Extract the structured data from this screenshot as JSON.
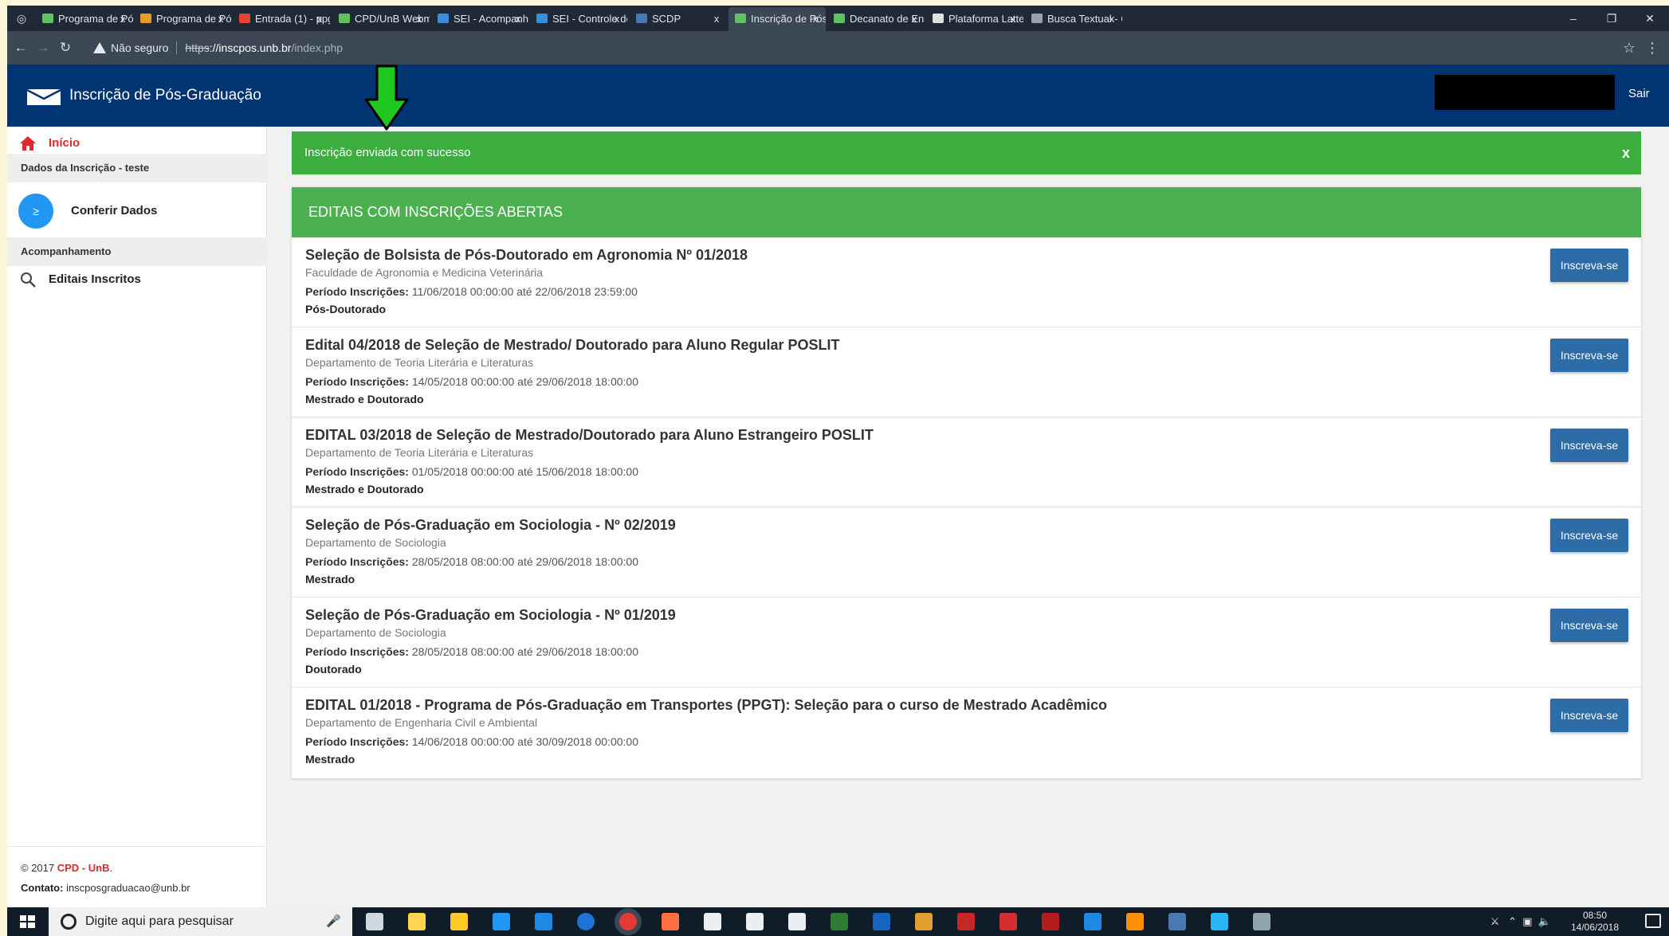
{
  "browser": {
    "tabs": [
      {
        "label": "Programa de Pós",
        "color": "#5fc15f"
      },
      {
        "label": "Programa de Pós",
        "color": "#e89b2a"
      },
      {
        "label": "Entrada (1) - ppg",
        "color": "#e84235"
      },
      {
        "label": "CPD/UnB Webma",
        "color": "#5fc15f"
      },
      {
        "label": "SEI - Acompanha",
        "color": "#3b8ed8"
      },
      {
        "label": "SEI - Controle de",
        "color": "#3b8ed8"
      },
      {
        "label": "SCDP",
        "color": "#4a78b5"
      },
      {
        "label": "Inscrição de Pós-",
        "color": "#5fc15f"
      },
      {
        "label": "Decanato de Ensi",
        "color": "#5fc15f"
      },
      {
        "label": "Plataforma Lattes",
        "color": "#e0e0e0"
      },
      {
        "label": "Busca Textual - C",
        "color": "#9aa0b0"
      }
    ],
    "tab_close": "x",
    "security_label": "Não seguro",
    "url_proto": "https",
    "url_host": "://inscpos.unb.br",
    "url_path": "/index.php"
  },
  "header": {
    "title": "Inscrição de Pós-Graduação",
    "logout": "Sair"
  },
  "sidebar": {
    "home": "Início",
    "section_dados": "Dados da Inscrição - teste",
    "conferir": "Conferir Dados",
    "section_acomp": "Acompanhamento",
    "editais": "Editais Inscritos",
    "footer_year": "© 2017",
    "footer_org": "CPD - UnB",
    "footer_dot": ".",
    "footer_contact_label": "Contato:",
    "footer_contact": "inscposgraduacao@unb.br"
  },
  "alert": {
    "message": "Inscrição enviada com sucesso",
    "close": "x"
  },
  "panel": {
    "heading": "EDITAIS COM INSCRIÇÕES ABERTAS",
    "period_label": "Período Inscrições:",
    "button_label": "Inscreva-se",
    "items": [
      {
        "title": "Seleção de Bolsista de Pós-Doutorado em Agronomia Nº 01/2018",
        "dept": "Faculdade de Agronomia e Medicina Veterinária",
        "period": "11/06/2018 00:00:00 até 22/06/2018 23:59:00",
        "level": "Pós-Doutorado"
      },
      {
        "title": "Edital 04/2018 de Seleção de Mestrado/ Doutorado para Aluno Regular POSLIT",
        "dept": "Departamento de Teoria Literária e Literaturas",
        "period": "14/05/2018 00:00:00 até 29/06/2018 18:00:00",
        "level": "Mestrado e Doutorado"
      },
      {
        "title": "EDITAL 03/2018 de Seleção de Mestrado/Doutorado para Aluno Estrangeiro POSLIT",
        "dept": "Departamento de Teoria Literária e Literaturas",
        "period": "01/05/2018 00:00:00 até 15/06/2018 18:00:00",
        "level": "Mestrado e Doutorado"
      },
      {
        "title": "Seleção de Pós-Graduação em Sociologia - Nº 02/2019",
        "dept": "Departamento de Sociologia",
        "period": "28/05/2018 08:00:00 até 29/06/2018 18:00:00",
        "level": "Mestrado"
      },
      {
        "title": "Seleção de Pós-Graduação em Sociologia - Nº 01/2019",
        "dept": "Departamento de Sociologia",
        "period": "28/05/2018 08:00:00 até 29/06/2018 18:00:00",
        "level": "Doutorado"
      },
      {
        "title": "EDITAL 01/2018 - Programa de Pós-Graduação em Transportes (PPGT): Seleção para o curso de Mestrado Acadêmico",
        "dept": "Departamento de Engenharia Civil e Ambiental",
        "period": "14/06/2018 00:00:00 até 30/09/2018 00:00:00",
        "level": "Mestrado"
      }
    ]
  },
  "taskbar": {
    "search_placeholder": "Digite aqui para pesquisar",
    "time": "08:50",
    "date": "14/06/2018",
    "app_colors": [
      "#cfd8dc",
      "#ffd54f",
      "#ffca28",
      "#2196f3",
      "#1e88e5",
      "#1e73d8",
      "#e53935",
      "#ff7043",
      "#eceff1",
      "#eceff1",
      "#eceff1",
      "#2e7d32",
      "#1565c0",
      "#e0a030",
      "#c62828",
      "#d32f2f",
      "#b71c1c",
      "#1e88e5",
      "#ff8f00",
      "#4a78b5",
      "#29b6f6",
      "#90a4ae"
    ]
  },
  "colors": {
    "header_bg": "#003473",
    "alert_bg": "#3cad3f",
    "panel_head_bg": "#4caf50",
    "button_bg": "#2e6ca8",
    "accent_red": "#e0282d",
    "annotation_arrow": "#1fc71f"
  }
}
